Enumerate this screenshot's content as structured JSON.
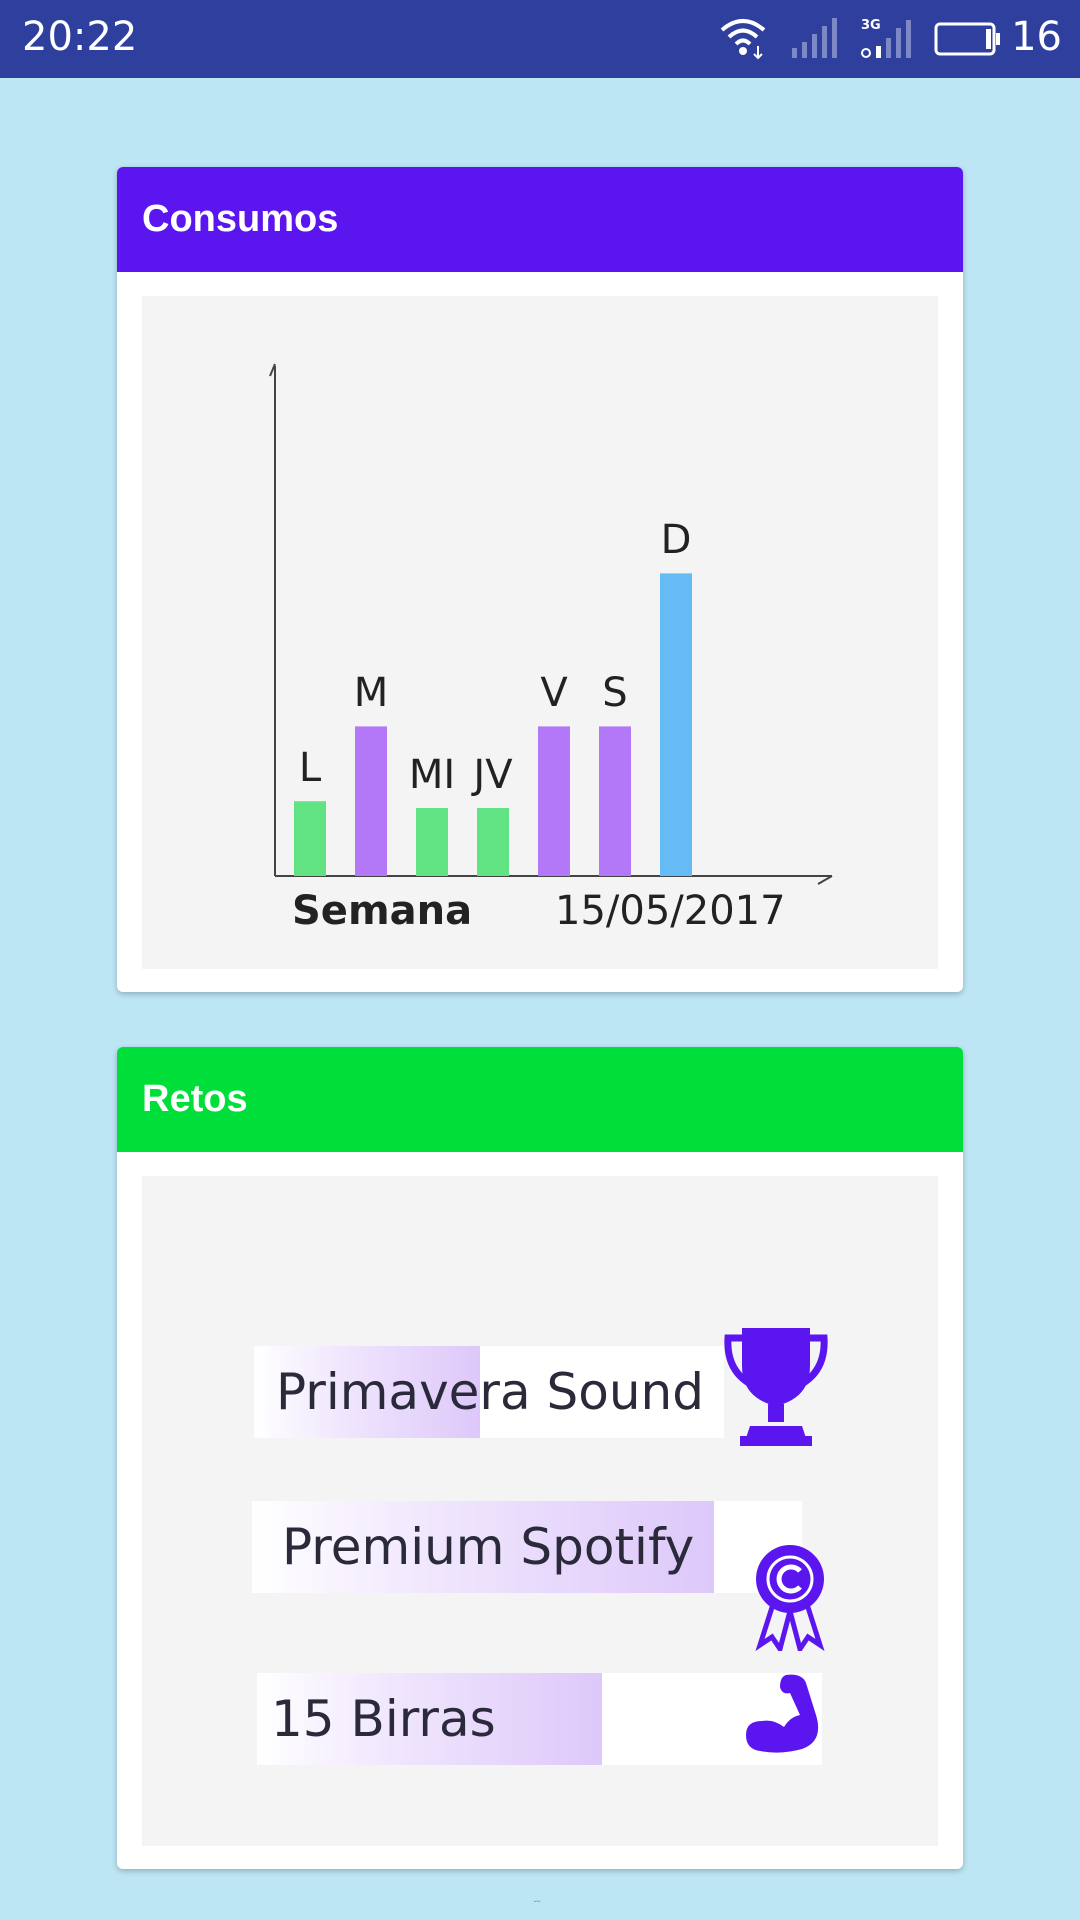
{
  "status_bar": {
    "time": "20:22",
    "battery_level": "16",
    "network_label": "3G",
    "background_color": "#2E3F9E"
  },
  "consumos_card": {
    "title": "Consumos",
    "header_color": "#5B16F0",
    "chart_data": {
      "type": "bar",
      "categories": [
        "L",
        "M",
        "MI",
        "JV",
        "V",
        "S",
        "D"
      ],
      "values": [
        22,
        44,
        20,
        20,
        44,
        44,
        89
      ],
      "colors": [
        "#62E383",
        "#B278F8",
        "#62E383",
        "#62E383",
        "#B278F8",
        "#B278F8",
        "#64BBF6"
      ],
      "xlabel": "Semana",
      "date": "15/05/2017",
      "ylim": [
        0,
        100
      ]
    }
  },
  "retos_card": {
    "title": "Retos",
    "header_color": "#00DE3A",
    "items": [
      {
        "label": "Primavera Sound",
        "progress": 0.48,
        "icon": "trophy-icon"
      },
      {
        "label": "Premium Spotify",
        "progress": 0.84,
        "icon": "award-ribbon-icon"
      },
      {
        "label": "15 Birras",
        "progress": 0.61,
        "icon": "flexed-arm-icon"
      }
    ],
    "icon_color": "#5B16F0"
  }
}
